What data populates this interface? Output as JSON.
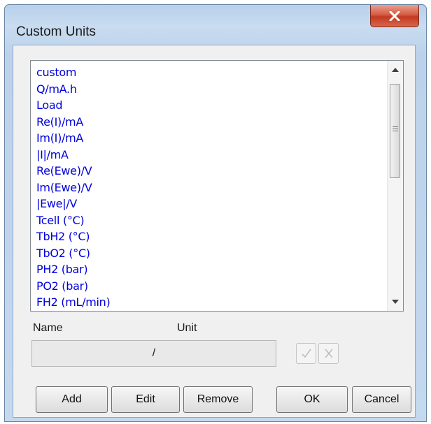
{
  "window": {
    "title": "Custom Units"
  },
  "units_list": {
    "items": [
      "custom",
      "Q/mA.h",
      "Load",
      "Re(I)/mA",
      "Im(I)/mA",
      "|I|/mA",
      "Re(Ewe)/V",
      "Im(Ewe)/V",
      "|Ewe|/V",
      "Tcell (°C)",
      "TbH2 (°C)",
      "TbO2 (°C)",
      "PH2 (bar)",
      "PO2 (bar)",
      "FH2 (mL/min)"
    ]
  },
  "form": {
    "name_label": "Name",
    "unit_label": "Unit",
    "unit_value": "/"
  },
  "buttons": {
    "add": "Add",
    "edit": "Edit",
    "remove": "Remove",
    "ok": "OK",
    "cancel": "Cancel"
  }
}
